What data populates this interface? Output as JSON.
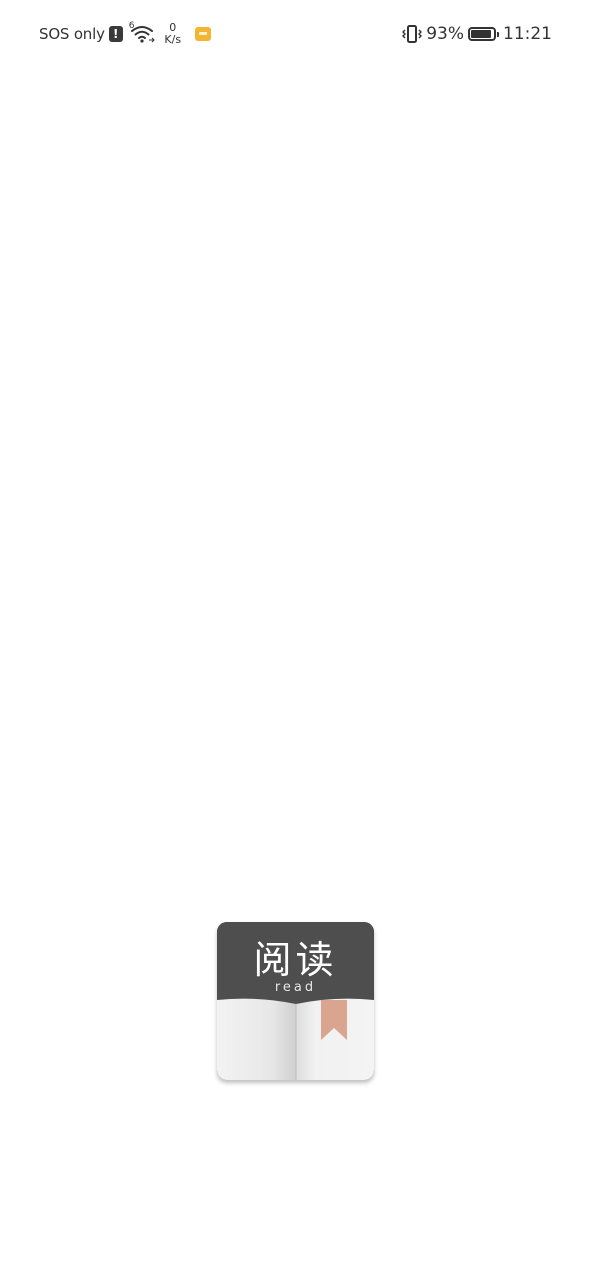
{
  "status_bar": {
    "carrier": "SOS only",
    "alert_icon": "exclamation-icon",
    "wifi_label": "6",
    "net_speed_value": "0",
    "net_speed_unit": "K/s",
    "battery_percent": "93%",
    "battery_level": 0.93,
    "time": "11:21"
  },
  "splash": {
    "logo_text_cn": "阅读",
    "logo_text_en": "read",
    "colors": {
      "logo_dark": "#4e4e4e",
      "bookmark": "#d9a58e",
      "page_light": "#f2f2f2"
    }
  }
}
